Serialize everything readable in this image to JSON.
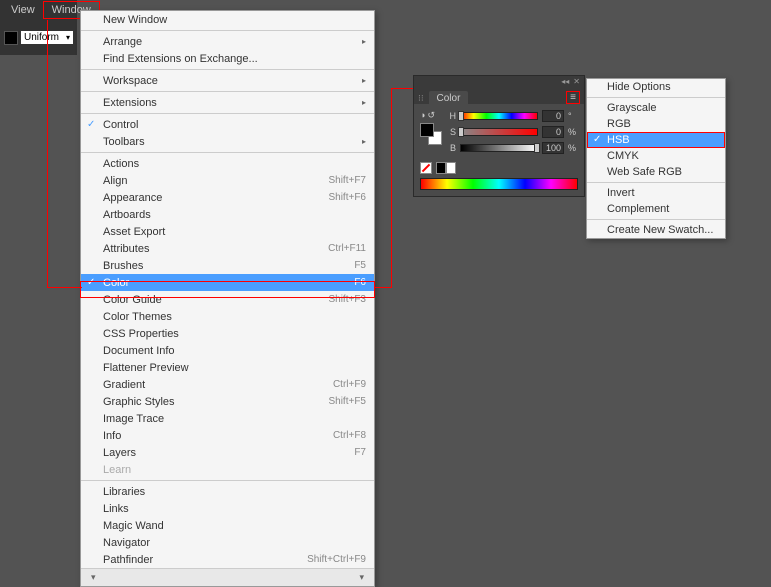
{
  "menubar": {
    "view": "View",
    "window": "Window"
  },
  "control": {
    "uniform": "Uniform"
  },
  "windowMenu": {
    "newWindow": "New Window",
    "arrange": "Arrange",
    "findExt": "Find Extensions on Exchange...",
    "workspace": "Workspace",
    "extensions": "Extensions",
    "control": "Control",
    "toolbars": "Toolbars",
    "actions": "Actions",
    "align": "Align",
    "alignSc": "Shift+F7",
    "appearance": "Appearance",
    "appearanceSc": "Shift+F6",
    "artboards": "Artboards",
    "assetExport": "Asset Export",
    "attributes": "Attributes",
    "attributesSc": "Ctrl+F11",
    "brushes": "Brushes",
    "brushesSc": "F5",
    "color": "Color",
    "colorSc": "F6",
    "colorGuide": "Color Guide",
    "colorGuideSc": "Shift+F3",
    "colorThemes": "Color Themes",
    "cssProps": "CSS Properties",
    "docInfo": "Document Info",
    "flattener": "Flattener Preview",
    "gradient": "Gradient",
    "gradientSc": "Ctrl+F9",
    "graphicStyles": "Graphic Styles",
    "graphicStylesSc": "Shift+F5",
    "imageTrace": "Image Trace",
    "info": "Info",
    "infoSc": "Ctrl+F8",
    "layers": "Layers",
    "layersSc": "F7",
    "learn": "Learn",
    "libraries": "Libraries",
    "links": "Links",
    "magicWand": "Magic Wand",
    "navigator": "Navigator",
    "pathfinder": "Pathfinder",
    "pathfinderSc": "Shift+Ctrl+F9"
  },
  "colorPanel": {
    "title": "Color",
    "h": "H",
    "hVal": "0",
    "hUnit": "°",
    "s": "S",
    "sVal": "0",
    "sUnit": "%",
    "b": "B",
    "bVal": "100",
    "bUnit": "%"
  },
  "flyout": {
    "hideOptions": "Hide Options",
    "grayscale": "Grayscale",
    "rgb": "RGB",
    "hsb": "HSB",
    "cmyk": "CMYK",
    "webSafe": "Web Safe RGB",
    "invert": "Invert",
    "complement": "Complement",
    "newSwatch": "Create New Swatch..."
  }
}
